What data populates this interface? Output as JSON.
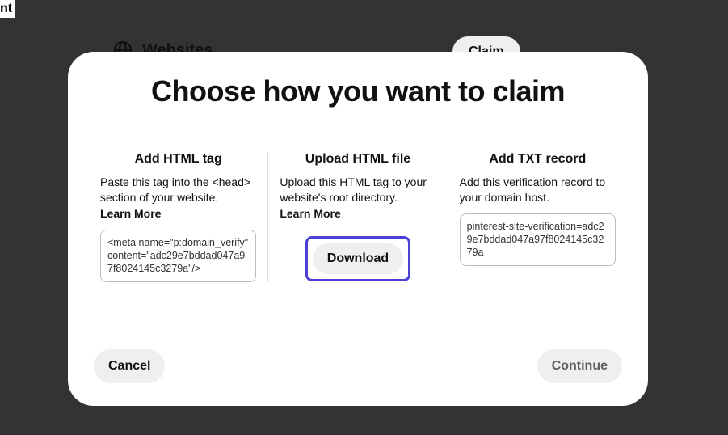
{
  "background": {
    "partial_text": "nt",
    "section_label": "Websites",
    "claim_button": "Claim"
  },
  "modal": {
    "title": "Choose how you want to claim",
    "columns": {
      "html_tag": {
        "title": "Add HTML tag",
        "desc": "Paste this tag into the <head> section of your website.",
        "learn_more": "Learn More",
        "code": "<meta name=\"p:domain_verify\" content=\"adc29e7bddad047a97f8024145c3279a\"/>"
      },
      "upload": {
        "title": "Upload HTML file",
        "desc": "Upload this HTML tag to your website's root directory.",
        "learn_more": "Learn More",
        "download_label": "Download"
      },
      "txt": {
        "title": "Add TXT record",
        "desc": "Add this verification record to your domain host.",
        "code": "pinterest-site-verification=adc29e7bddad047a97f8024145c3279a"
      }
    },
    "footer": {
      "cancel": "Cancel",
      "continue": "Continue"
    }
  }
}
